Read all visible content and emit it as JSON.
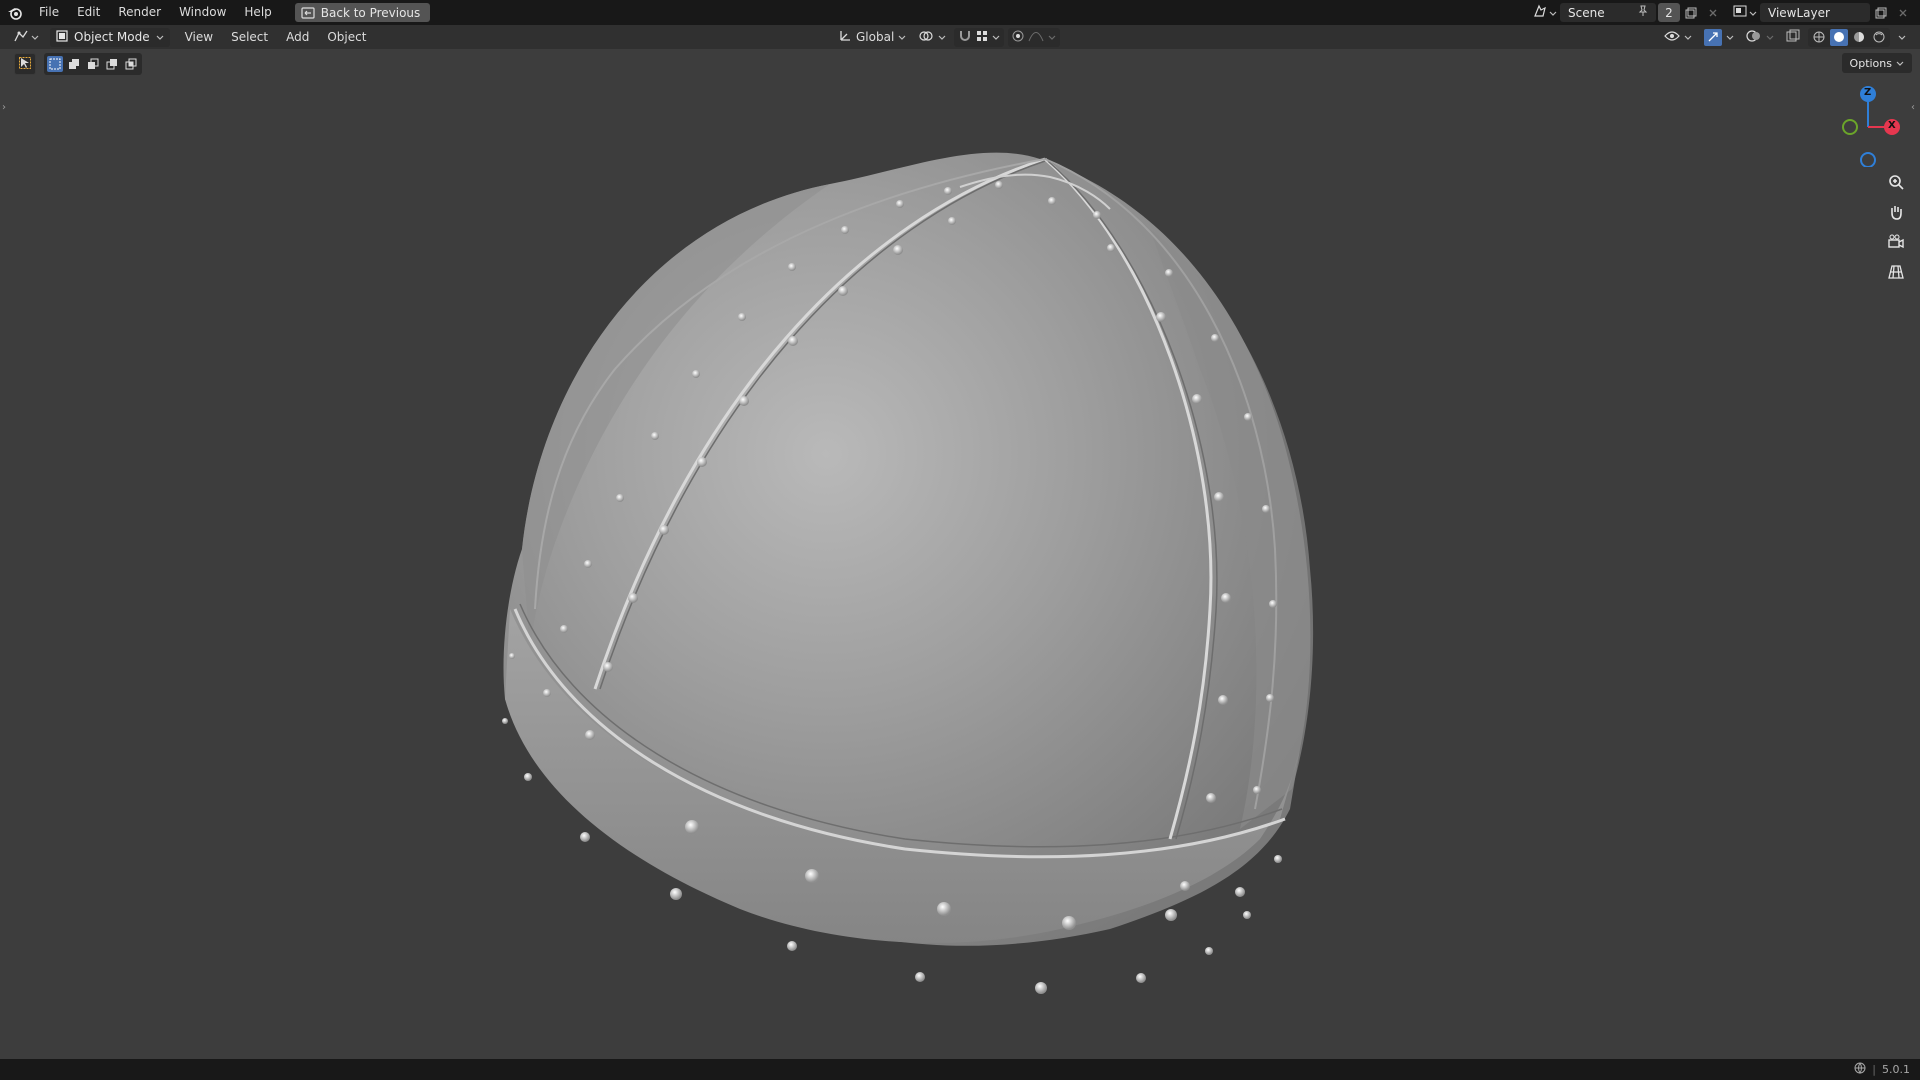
{
  "topbar": {
    "menus": [
      "File",
      "Edit",
      "Render",
      "Window",
      "Help"
    ],
    "back_button": "Back to Previous",
    "scene_name": "Scene",
    "scene_users": "2",
    "view_layer": "ViewLayer"
  },
  "header": {
    "mode": "Object Mode",
    "menus": [
      "View",
      "Select",
      "Add",
      "Object"
    ],
    "transform_orientation": "Global"
  },
  "options_label": "Options",
  "gizmo": {
    "z_label": "Z",
    "x_label": "X"
  },
  "status": {
    "version": "5.0.1"
  },
  "colors": {
    "accent": "#4772b3",
    "axis_x": "#e6374f",
    "axis_y": "#6ba52a",
    "axis_z": "#2f7fd8",
    "topbar_bg": "#181818",
    "header_bg": "#303030",
    "viewport_bg": "#3d3d3d"
  },
  "icons": {
    "logo": "blender-logo-icon",
    "zoom": "zoom-icon",
    "pan": "hand-icon",
    "camera": "camera-icon",
    "perspective": "grid-icon"
  }
}
